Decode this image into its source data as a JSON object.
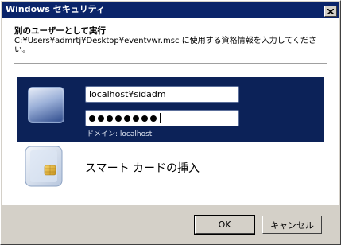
{
  "window": {
    "title": "Windows セキュリティ"
  },
  "dialog": {
    "heading": "別のユーザーとして実行",
    "description": "C:¥Users¥admrtj¥Desktop¥eventvwr.msc に使用する資格情報を入力してください。"
  },
  "credentials": {
    "username_value": "localhost¥sidadm",
    "password_mask": "●●●●●●●●",
    "domain_label": "ドメイン: localhost"
  },
  "smartcard": {
    "label": "スマート カードの挿入"
  },
  "buttons": {
    "ok": "OK",
    "cancel": "キャンセル"
  },
  "colors": {
    "titlebar": "#0a246a",
    "credential_panel": "#0c2258",
    "dialog_bg": "#d4d0c8"
  },
  "icons": {
    "close": "close-icon",
    "user_tile": "user-tile-icon",
    "smartcard": "smartcard-icon"
  }
}
